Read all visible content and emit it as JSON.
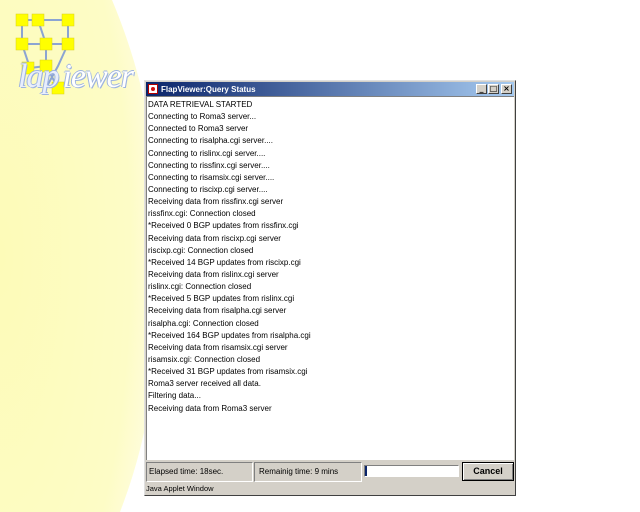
{
  "window": {
    "title": "FlapViewer:Query Status",
    "minimize_label": "_",
    "maximize_label": "□",
    "close_label": "×"
  },
  "log_lines": [
    "DATA RETRIEVAL STARTED",
    "Connecting to Roma3 server...",
    "Connected to Roma3 server",
    "Connecting to risalpha.cgi server....",
    "Connecting to rislinx.cgi server....",
    "Connecting to rissfinx.cgi server....",
    "Connecting to risamsix.cgi server....",
    "Connecting to riscixp.cgi server....",
    "Receiving data from rissfinx.cgi server",
    "rissfinx.cgi: Connection closed",
    "*Received 0 BGP updates from rissfinx.cgi",
    "Receiving data from riscixp.cgi server",
    "riscixp.cgi: Connection closed",
    "*Received 14 BGP updates from riscixp.cgi",
    "Receiving data from rislinx.cgi server",
    "rislinx.cgi: Connection closed",
    "*Received 5 BGP updates from rislinx.cgi",
    "Receiving data from risalpha.cgi server",
    "risalpha.cgi: Connection closed",
    "*Received 164 BGP updates from risalpha.cgi",
    "Receiving data from risamsix.cgi server",
    "risamsix.cgi: Connection closed",
    "*Received 31 BGP updates from risamsix.cgi",
    "Roma3 server received all data.",
    "Filtering data...",
    "Receiving data from Roma3 server"
  ],
  "status": {
    "elapsed": "Elapsed time: 18sec.",
    "remaining": "Remainig time: 9 mins",
    "progress_fraction": 0.02,
    "cancel_label": "Cancel"
  },
  "applet_label": "Java Applet Window",
  "logo": {
    "part1": "lap",
    "part2": "iewer"
  },
  "colors": {
    "titlebar_start": "#0a246a",
    "titlebar_end": "#a6caf0",
    "window_face": "#d4d0c8",
    "background_yellow": "#fdfbb8"
  }
}
